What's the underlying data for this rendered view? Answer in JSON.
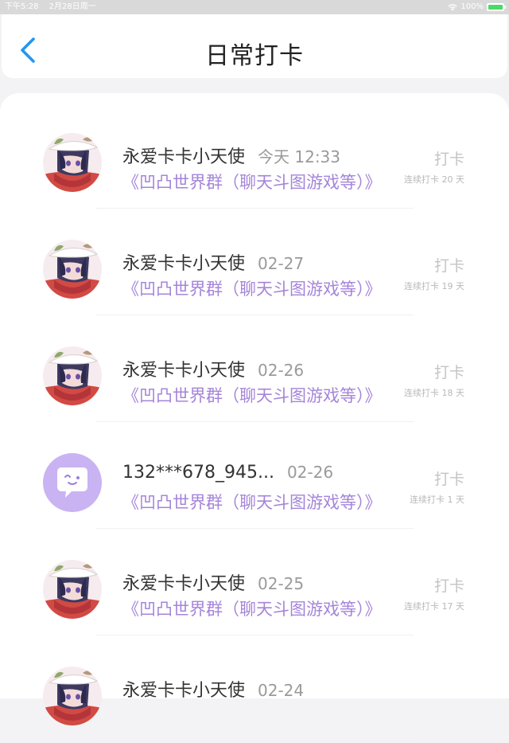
{
  "status_bar": {
    "time": "下午5:28",
    "date": "2月28日周一",
    "battery_text": "100%",
    "battery_level": 1.0,
    "battery_color": "#4cd964"
  },
  "header": {
    "title": "日常打卡",
    "back_icon": "chevron-left-icon",
    "back_color": "#2196f3"
  },
  "colors": {
    "group_name": "#a585d9",
    "username": "#333333",
    "muted": "#9a9a9a",
    "checkin": "#c4c4c4",
    "default_avatar_bg": "#c9b3f2"
  },
  "entries": [
    {
      "username": "永爱卡卡小天使",
      "date": "今天 12:33",
      "group": "《凹凸世界群（聊天斗图游戏等）》",
      "action": "打卡",
      "streak": "连续打卡 20 天",
      "avatar": "anime-avatar"
    },
    {
      "username": "永爱卡卡小天使",
      "date": "02-27",
      "group": "《凹凸世界群（聊天斗图游戏等）》",
      "action": "打卡",
      "streak": "连续打卡 19 天",
      "avatar": "anime-avatar"
    },
    {
      "username": "永爱卡卡小天使",
      "date": "02-26",
      "group": "《凹凸世界群（聊天斗图游戏等）》",
      "action": "打卡",
      "streak": "连续打卡 18 天",
      "avatar": "anime-avatar"
    },
    {
      "username": "132***678_945...",
      "date": "02-26",
      "group": "《凹凸世界群（聊天斗图游戏等）》",
      "action": "打卡",
      "streak": "连续打卡 1 天",
      "avatar": "default-chat-avatar"
    },
    {
      "username": "永爱卡卡小天使",
      "date": "02-25",
      "group": "《凹凸世界群（聊天斗图游戏等）》",
      "action": "打卡",
      "streak": "连续打卡 17 天",
      "avatar": "anime-avatar"
    },
    {
      "username": "永爱卡卡小天使",
      "date": "02-24",
      "group": "",
      "action": "",
      "streak": "",
      "avatar": "anime-avatar"
    }
  ]
}
